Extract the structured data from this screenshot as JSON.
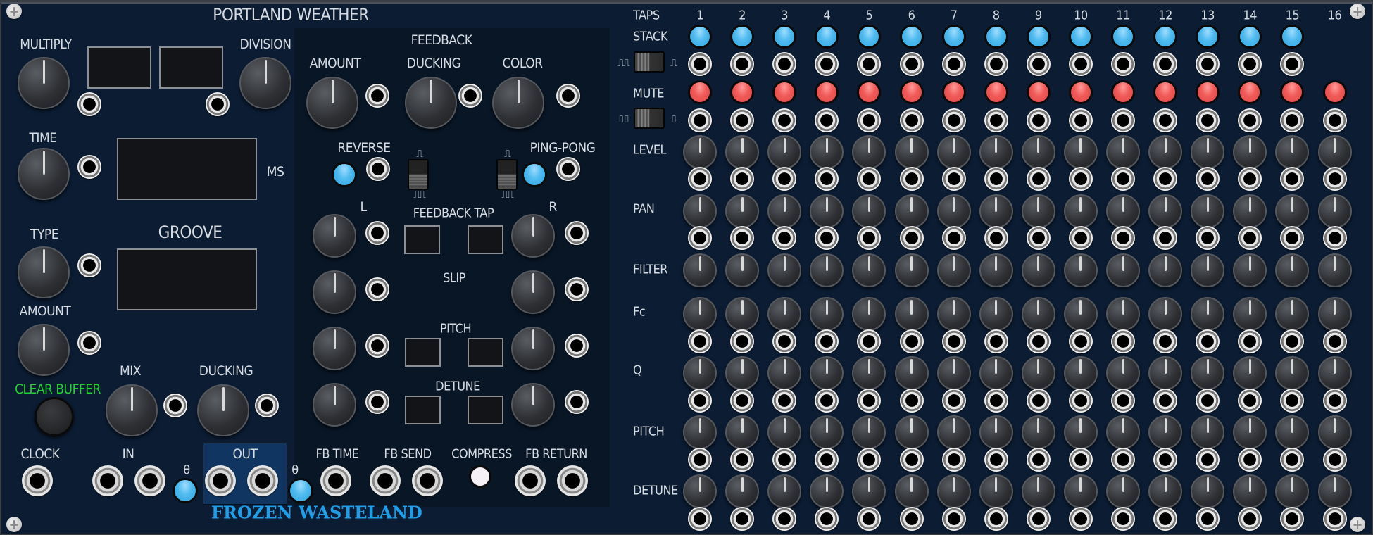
{
  "module": {
    "title": "PORTLAND WEATHER",
    "brand": "FROZEN WASTELAND"
  },
  "left": {
    "multiply_label": "MULTIPLY",
    "division_label": "DIVISION",
    "time_label": "TIME",
    "ms_label": "MS",
    "groove_label": "GROOVE",
    "type_label": "TYPE",
    "amount_label": "AMOUNT",
    "clear_buffer_label": "CLEAR BUFFER",
    "mix_label": "MIX",
    "ducking_label": "DUCKING",
    "clock_label": "CLOCK",
    "in_label": "IN",
    "out_label": "OUT",
    "theta_label": "θ",
    "displays": {
      "multiply": "",
      "division": "",
      "time_ms": "",
      "groove": ""
    }
  },
  "feedback": {
    "header": "FEEDBACK",
    "amount_label": "AMOUNT",
    "ducking_label": "DUCKING",
    "color_label": "COLOR",
    "reverse_label": "REVERSE",
    "pingpong_label": "PING-PONG",
    "l_label": "L",
    "r_label": "R",
    "feedback_tap_label": "FEEDBACK TAP",
    "slip_label": "SLIP",
    "pitch_label": "PITCH",
    "detune_label": "DETUNE",
    "fb_time_label": "FB TIME",
    "fb_send_label": "FB SEND",
    "compress_label": "COMPRESS",
    "fb_return_label": "FB RETURN",
    "switch_single": "⎍",
    "switch_multi": "⎍⎍",
    "reverse_on": true,
    "pingpong_on": true,
    "compress_on": true
  },
  "taps": {
    "header": "TAPS",
    "numbers": [
      "1",
      "2",
      "3",
      "4",
      "5",
      "6",
      "7",
      "8",
      "9",
      "10",
      "11",
      "12",
      "13",
      "14",
      "15",
      "16"
    ],
    "rows": {
      "stack": "STACK",
      "mute": "MUTE",
      "level": "LEVEL",
      "pan": "PAN",
      "filter": "FILTER",
      "fc": "Fc",
      "q": "Q",
      "pitch": "PITCH",
      "detune": "DETUNE"
    },
    "stack_leds": [
      true,
      true,
      true,
      true,
      true,
      true,
      true,
      true,
      true,
      true,
      true,
      true,
      true,
      true,
      true,
      false
    ],
    "mute_leds": [
      true,
      true,
      true,
      true,
      true,
      true,
      true,
      true,
      true,
      true,
      true,
      true,
      true,
      true,
      true,
      true
    ],
    "stack_jack_count": 15,
    "mute_switch_left": "⎍⎍",
    "mute_switch_right": "⎍",
    "colors": {
      "stack_led": "#4fbbef",
      "mute_led": "#f05a58",
      "panel": "#0b1c33",
      "brand": "#1e9ee8",
      "clear_buffer": "#22d133"
    }
  }
}
